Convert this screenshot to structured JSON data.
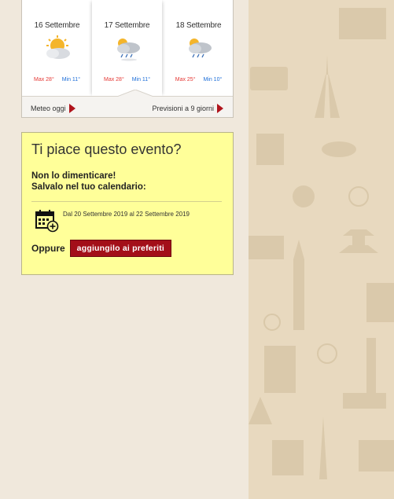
{
  "weather": {
    "days": [
      {
        "date": "16 Settembre",
        "icon": "sun-cloud-icon",
        "max": "Max 28°",
        "min": "Min 11°"
      },
      {
        "date": "17 Settembre",
        "icon": "rain-cloud-sun-icon",
        "max": "Max 28°",
        "min": "Min 11°"
      },
      {
        "date": "18 Settembre",
        "icon": "rain-cloud-sun-icon",
        "max": "Max 25°",
        "min": "Min 10°"
      }
    ],
    "today_link": "Meteo oggi",
    "forecast_link": "Previsioni a 9 giorni"
  },
  "event": {
    "title": "Ti piace questo evento?",
    "subtitle_line1": "Non lo dimenticare!",
    "subtitle_line2": "Salvalo nel tuo calendario:",
    "calendar_text": "Dal 20 Settembre 2019 al 22 Settembre 2019",
    "or_label": "Oppure",
    "favorite_button": "aggiungilo ai preferiti"
  },
  "colors": {
    "accent_red": "#a30f19",
    "max_temp": "#e53935",
    "min_temp": "#1e6fd9",
    "event_bg": "#ffff99"
  }
}
